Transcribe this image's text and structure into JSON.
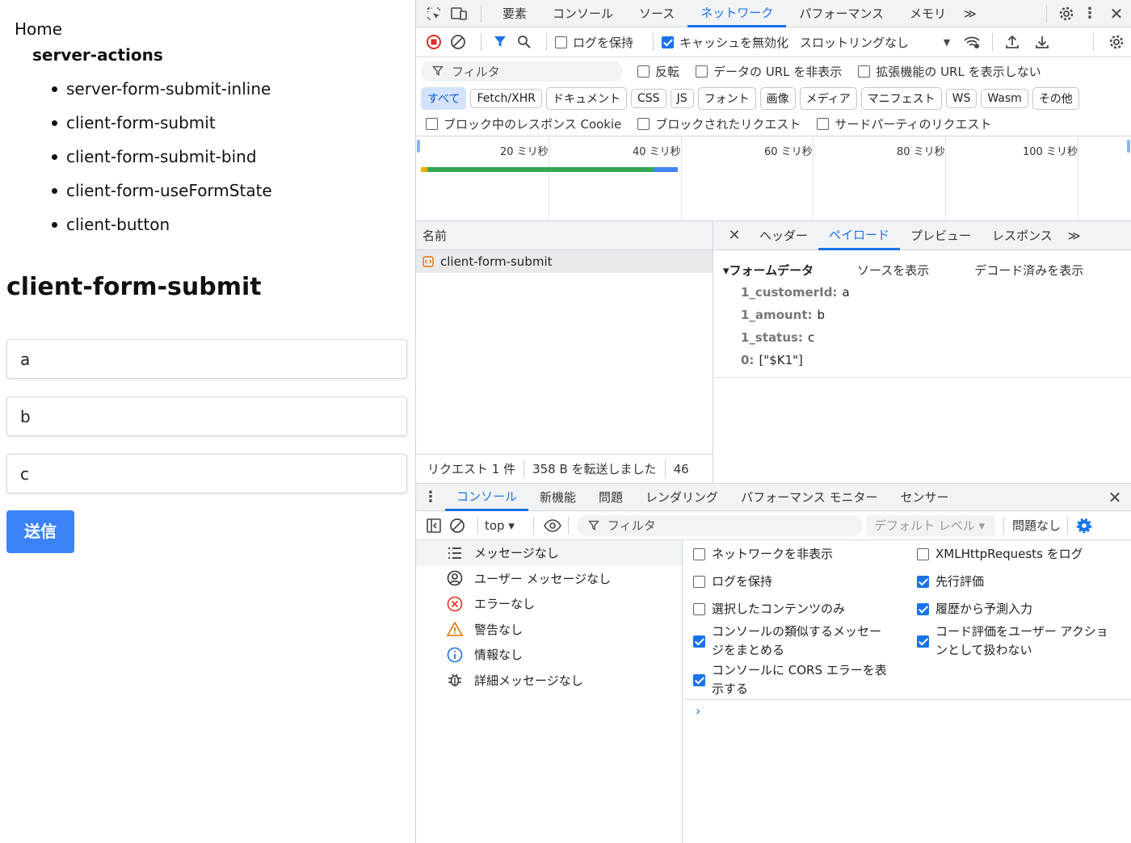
{
  "page": {
    "home": "Home",
    "section": "server-actions",
    "links": [
      "server-form-submit-inline",
      "client-form-submit",
      "client-form-submit-bind",
      "client-form-useFormState",
      "client-button"
    ],
    "heading": "client-form-submit",
    "fields": [
      "a",
      "b",
      "c"
    ],
    "submit": "送信"
  },
  "devtools": {
    "tabs": [
      "要素",
      "コンソール",
      "ソース",
      "ネットワーク",
      "パフォーマンス",
      "メモリ"
    ],
    "active_tab": "ネットワーク",
    "more": "≫",
    "toolbar": {
      "preserve_log": "ログを保持",
      "disable_cache": "キャッシュを無効化",
      "throttling": "スロットリングなし"
    },
    "filter": {
      "placeholder": "フィルタ",
      "invert": "反転",
      "hide_data_urls": "データの URL を非表示",
      "hide_ext_urls": "拡張機能の URL を表示しない"
    },
    "types": [
      "すべて",
      "Fetch/XHR",
      "ドキュメント",
      "CSS",
      "JS",
      "フォント",
      "画像",
      "メディア",
      "マニフェスト",
      "WS",
      "Wasm",
      "その他"
    ],
    "blocked": {
      "response_cookies": "ブロック中のレスポンス Cookie",
      "blocked_requests": "ブロックされたリクエスト",
      "third_party": "サードパーティのリクエスト"
    },
    "timeline_ticks": [
      "20 ミリ秒",
      "40 ミリ秒",
      "60 ミリ秒",
      "80 ミリ秒",
      "100 ミリ秒"
    ],
    "list": {
      "header": "名前",
      "request": "client-form-submit",
      "footer_requests": "リクエスト 1 件",
      "footer_transferred": "358 B を転送しました",
      "footer_more": "46"
    },
    "detail": {
      "tabs": [
        "ヘッダー",
        "ペイロード",
        "プレビュー",
        "レスポンス"
      ],
      "active": "ペイロード",
      "form_data_title": "▾フォームデータ",
      "view_source": "ソースを表示",
      "view_decoded": "デコード済みを表示",
      "entries": [
        {
          "key": "1_customerId:",
          "value": "a"
        },
        {
          "key": "1_amount:",
          "value": "b"
        },
        {
          "key": "1_status:",
          "value": "c"
        },
        {
          "key": "0:",
          "value": "[\"$K1\"]"
        }
      ]
    },
    "drawer": {
      "tabs": [
        "コンソール",
        "新機能",
        "問題",
        "レンダリング",
        "パフォーマンス モニター",
        "センサー"
      ],
      "active": "コンソール",
      "context": "top ▾",
      "filter": "フィルタ",
      "level": "デフォルト レベル ▾",
      "issues": "問題なし",
      "sidebar": [
        {
          "icon": "list-icon",
          "label": "メッセージなし"
        },
        {
          "icon": "user-icon",
          "label": "ユーザー メッセージなし"
        },
        {
          "icon": "error-icon",
          "label": "エラーなし"
        },
        {
          "icon": "warning-icon",
          "label": "警告なし"
        },
        {
          "icon": "info-icon",
          "label": "情報なし"
        },
        {
          "icon": "bug-icon",
          "label": "詳細メッセージなし"
        }
      ],
      "settings": {
        "hide_network": "ネットワークを非表示",
        "log_xhr": "XMLHttpRequests をログ",
        "preserve_log": "ログを保持",
        "eager_eval": "先行評価",
        "selected_context": "選択したコンテンツのみ",
        "autocomplete": "履歴から予測入力",
        "group_similar_1": "コンソールの類似するメッセー",
        "group_similar_2": "ジをまとめる",
        "user_gesture_1": "コード評価をユーザー アクショ",
        "user_gesture_2": "ンとして扱わない",
        "cors_1": "コンソールに CORS エラーを表",
        "cors_2": "示する"
      },
      "prompt": "›"
    }
  }
}
